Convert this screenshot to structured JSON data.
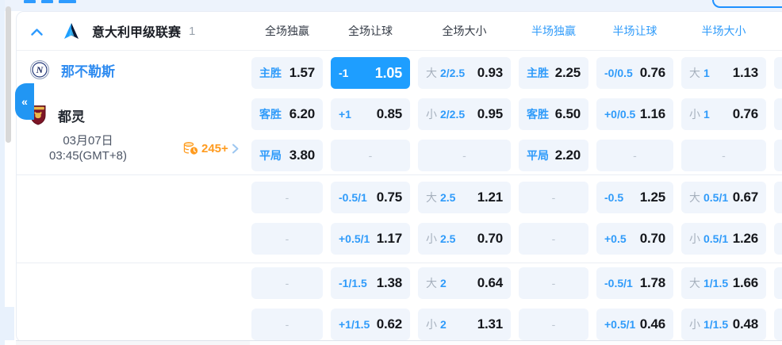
{
  "colors": {
    "accent": "#1e9eff",
    "label_blue": "#2f9bfa",
    "odds_text": "#15171c",
    "muted_gray": "#a6b0bd",
    "dash_gray": "#bcc5d0",
    "orange": "#ff9b1f",
    "cell_bg": "#f0f5fc",
    "header_dark": "#333a45",
    "home_team_blue": "#2e8bf0"
  },
  "league_header": {
    "name": "意大利甲级联赛",
    "count": "1"
  },
  "market_columns": [
    {
      "label": "全场独赢"
    },
    {
      "label": "全场让球"
    },
    {
      "label": "全场大小"
    },
    {
      "label": "半场独赢"
    },
    {
      "label": "半场让球"
    },
    {
      "label": "半场大小"
    }
  ],
  "match": {
    "home_team": "那不勒斯",
    "away_team": "都灵",
    "date": "03月07日",
    "time": "03:45(GMT+8)",
    "more_markets": "245+",
    "collapse_glyph": "«"
  },
  "odds": {
    "dash": "-",
    "groups": [
      {
        "rows": [
          {
            "cells": [
              {
                "t": "pair",
                "l": "主胜",
                "v": "1.57"
              },
              {
                "t": "pair",
                "l": "-1",
                "v": "1.05",
                "sel": true
              },
              {
                "t": "ou",
                "b": "大",
                "l": "2/2.5",
                "v": "0.93"
              },
              {
                "t": "pair",
                "l": "主胜",
                "v": "2.25"
              },
              {
                "t": "pair",
                "l": "-0/0.5",
                "v": "0.76"
              },
              {
                "t": "ou",
                "b": "大",
                "l": "1",
                "v": "1.13"
              }
            ]
          },
          {
            "cells": [
              {
                "t": "pair",
                "l": "客胜",
                "v": "6.20"
              },
              {
                "t": "pair",
                "l": "+1",
                "v": "0.85"
              },
              {
                "t": "ou",
                "b": "小",
                "l": "2/2.5",
                "v": "0.95"
              },
              {
                "t": "pair",
                "l": "客胜",
                "v": "6.50"
              },
              {
                "t": "pair",
                "l": "+0/0.5",
                "v": "1.16"
              },
              {
                "t": "ou",
                "b": "小",
                "l": "1",
                "v": "0.76"
              }
            ]
          },
          {
            "cells": [
              {
                "t": "pair",
                "l": "平局",
                "v": "3.80"
              },
              {
                "t": "dash"
              },
              {
                "t": "dash"
              },
              {
                "t": "pair",
                "l": "平局",
                "v": "2.20"
              },
              {
                "t": "dash"
              },
              {
                "t": "dash"
              }
            ]
          }
        ]
      },
      {
        "rows": [
          {
            "cells": [
              {
                "t": "dash"
              },
              {
                "t": "pair",
                "l": "-0.5/1",
                "v": "0.75"
              },
              {
                "t": "ou",
                "b": "大",
                "l": "2.5",
                "v": "1.21"
              },
              {
                "t": "dash"
              },
              {
                "t": "pair",
                "l": "-0.5",
                "v": "1.25"
              },
              {
                "t": "ou",
                "b": "大",
                "l": "0.5/1",
                "v": "0.67"
              }
            ]
          },
          {
            "cells": [
              {
                "t": "dash"
              },
              {
                "t": "pair",
                "l": "+0.5/1",
                "v": "1.17"
              },
              {
                "t": "ou",
                "b": "小",
                "l": "2.5",
                "v": "0.70"
              },
              {
                "t": "dash"
              },
              {
                "t": "pair",
                "l": "+0.5",
                "v": "0.70"
              },
              {
                "t": "ou",
                "b": "小",
                "l": "0.5/1",
                "v": "1.26"
              }
            ]
          }
        ]
      },
      {
        "rows": [
          {
            "cells": [
              {
                "t": "dash"
              },
              {
                "t": "pair",
                "l": "-1/1.5",
                "v": "1.38"
              },
              {
                "t": "ou",
                "b": "大",
                "l": "2",
                "v": "0.64"
              },
              {
                "t": "dash"
              },
              {
                "t": "pair",
                "l": "-0.5/1",
                "v": "1.78"
              },
              {
                "t": "ou",
                "b": "大",
                "l": "1/1.5",
                "v": "1.66"
              }
            ]
          },
          {
            "cells": [
              {
                "t": "dash"
              },
              {
                "t": "pair",
                "l": "+1/1.5",
                "v": "0.62"
              },
              {
                "t": "ou",
                "b": "小",
                "l": "2",
                "v": "1.31"
              },
              {
                "t": "dash"
              },
              {
                "t": "pair",
                "l": "+0.5/1",
                "v": "0.46"
              },
              {
                "t": "ou",
                "b": "小",
                "l": "1/1.5",
                "v": "0.48"
              }
            ]
          }
        ]
      }
    ]
  }
}
